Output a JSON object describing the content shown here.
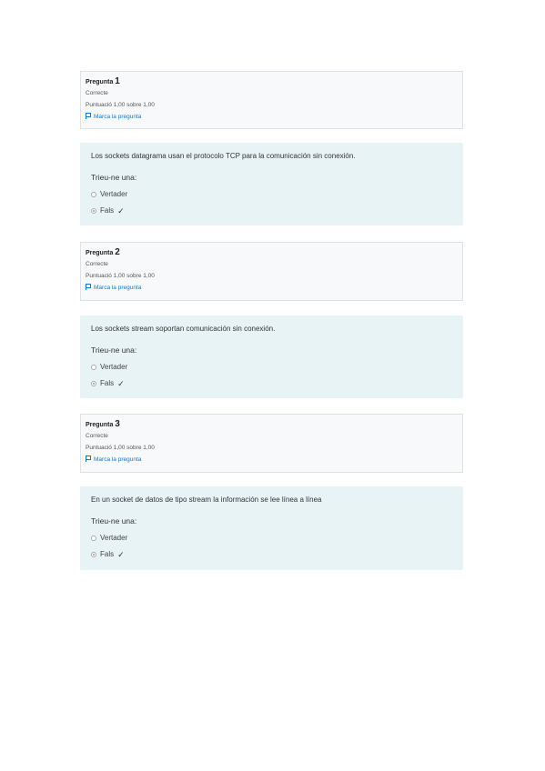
{
  "questions": [
    {
      "label": "Pregunta",
      "number": "1",
      "state": "Correcte",
      "grade": "Puntuació 1,00 sobre 1,00",
      "flag": "Marca la pregunta",
      "text": "Los sockets datagrama usan el protocolo TCP para la comunicación sin conexión.",
      "prompt": "Trieu-ne una:",
      "options": [
        {
          "label": "Vertader",
          "checked": false
        },
        {
          "label": "Fals",
          "checked": true
        }
      ]
    },
    {
      "label": "Pregunta",
      "number": "2",
      "state": "Correcte",
      "grade": "Puntuació 1,00 sobre 1,00",
      "flag": "Marca la pregunta",
      "text": "Los sockets stream soportan comunicación sin conexión.",
      "prompt": "Trieu-ne una:",
      "options": [
        {
          "label": "Vertader",
          "checked": false
        },
        {
          "label": "Fals",
          "checked": true
        }
      ]
    },
    {
      "label": "Pregunta",
      "number": "3",
      "state": "Correcte",
      "grade": "Puntuació 1,00 sobre 1,00",
      "flag": "Marca la pregunta",
      "text": "En un socket de datos de tipo stream la información se lee línea a línea",
      "prompt": "Trieu-ne una:",
      "options": [
        {
          "label": "Vertader",
          "checked": false
        },
        {
          "label": "Fals",
          "checked": true
        }
      ]
    }
  ],
  "correct_mark": "✓"
}
